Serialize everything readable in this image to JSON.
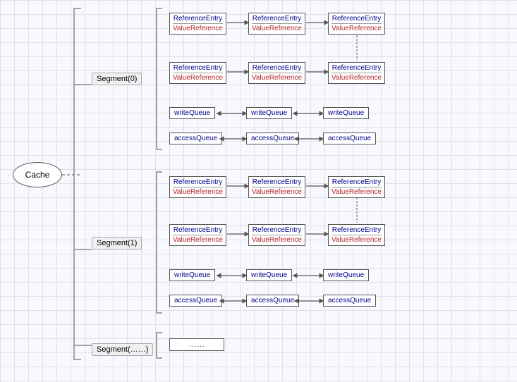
{
  "cache": {
    "label": "Cache"
  },
  "segments": [
    {
      "label": "Segment(0)"
    },
    {
      "label": "Segment(1)"
    },
    {
      "label": "Segment(……)"
    }
  ],
  "entry": {
    "line1": "ReferenceEntry",
    "line2": "ValueReference"
  },
  "queues": {
    "write": "writeQueue",
    "access": "accessQueue",
    "dots": "……"
  }
}
